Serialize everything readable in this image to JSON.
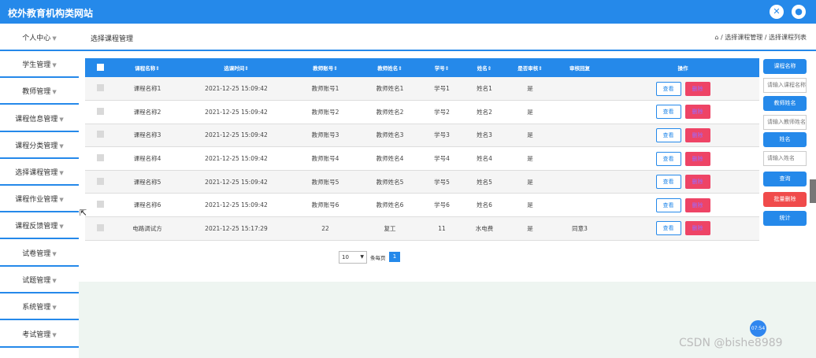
{
  "header": {
    "title": "校外教育机构类网站",
    "icons": [
      "close-icon",
      "user-icon"
    ]
  },
  "sidebar": {
    "items": [
      {
        "label": "个人中心"
      },
      {
        "label": "学生管理"
      },
      {
        "label": "教师管理"
      },
      {
        "label": "课程信息管理"
      },
      {
        "label": "课程分类管理"
      },
      {
        "label": "选择课程管理"
      },
      {
        "label": "课程作业管理"
      },
      {
        "label": "课程反馈管理"
      },
      {
        "label": "试卷管理"
      },
      {
        "label": "试题管理"
      },
      {
        "label": "系统管理"
      },
      {
        "label": "考试管理"
      }
    ]
  },
  "breadcrumb": {
    "page_title": "选择课程管理",
    "path": "⌂ / 选择课程管理 / 选择课程列表"
  },
  "table": {
    "columns": [
      "",
      "课程名称⇕",
      "选课时间⇕",
      "教师账号⇕",
      "教师姓名⇕",
      "学号⇕",
      "姓名⇕",
      "是否审核⇕",
      "审核回复",
      "操作"
    ],
    "rows": [
      [
        "",
        "课程名称1",
        "2021-12-25 15:09:42",
        "教师账号1",
        "教师姓名1",
        "学号1",
        "姓名1",
        "是",
        ""
      ],
      [
        "",
        "课程名称2",
        "2021-12-25 15:09:42",
        "教师账号2",
        "教师姓名2",
        "学号2",
        "姓名2",
        "是",
        ""
      ],
      [
        "",
        "课程名称3",
        "2021-12-25 15:09:42",
        "教师账号3",
        "教师姓名3",
        "学号3",
        "姓名3",
        "是",
        ""
      ],
      [
        "",
        "课程名称4",
        "2021-12-25 15:09:42",
        "教师账号4",
        "教师姓名4",
        "学号4",
        "姓名4",
        "是",
        ""
      ],
      [
        "",
        "课程名称5",
        "2021-12-25 15:09:42",
        "教师账号5",
        "教师姓名5",
        "学号5",
        "姓名5",
        "是",
        ""
      ],
      [
        "",
        "课程名称6",
        "2021-12-25 15:09:42",
        "教师账号6",
        "教师姓名6",
        "学号6",
        "姓名6",
        "是",
        ""
      ],
      [
        "",
        "电路调试方",
        "2021-12-25 15:17:29",
        "22",
        "复工",
        "11",
        "水电费",
        "是",
        "同意3"
      ]
    ],
    "view_label": "查看",
    "delete_label": "删除"
  },
  "pagination": {
    "page_size": "10",
    "per_page_label": "条每页",
    "current_page": "1"
  },
  "search_panel": {
    "course_name_label": "课程名称",
    "course_name_placeholder": "请输入课程名称",
    "teacher_name_label": "教师姓名",
    "teacher_name_placeholder": "请输入教师姓名",
    "student_name_label": "姓名",
    "student_name_placeholder": "请输入姓名",
    "search_label": "查询",
    "batch_delete_label": "批量删除",
    "stats_label": "统计"
  },
  "overlay": {
    "badge_text": "07:54",
    "watermark": "CSDN @bishe8989"
  },
  "colors": {
    "primary": "#2589ea",
    "danger": "#ee4466",
    "batch_delete": "#f04b4b",
    "footer_band": "#eef5f1"
  }
}
